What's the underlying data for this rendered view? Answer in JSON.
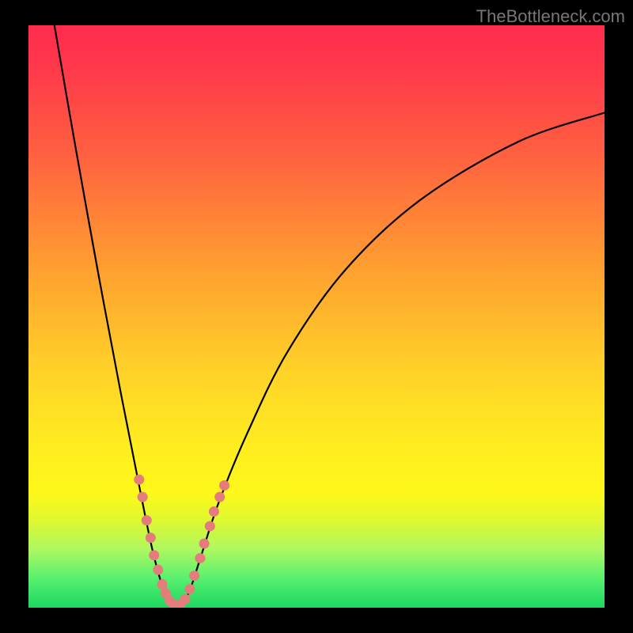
{
  "watermark": "TheBottleneck.com",
  "chart_data": {
    "type": "line",
    "title": "",
    "xlabel": "",
    "ylabel": "",
    "xlim": [
      0,
      100
    ],
    "ylim": [
      0,
      100
    ],
    "curve_points": [
      {
        "x": 4.5,
        "y": 100
      },
      {
        "x": 8,
        "y": 80
      },
      {
        "x": 12,
        "y": 58
      },
      {
        "x": 16,
        "y": 37
      },
      {
        "x": 19,
        "y": 22
      },
      {
        "x": 21.5,
        "y": 10
      },
      {
        "x": 23.5,
        "y": 3
      },
      {
        "x": 25,
        "y": 0.5
      },
      {
        "x": 26.5,
        "y": 0.5
      },
      {
        "x": 28,
        "y": 3
      },
      {
        "x": 30,
        "y": 9
      },
      {
        "x": 33,
        "y": 18
      },
      {
        "x": 38,
        "y": 30
      },
      {
        "x": 45,
        "y": 44
      },
      {
        "x": 55,
        "y": 58
      },
      {
        "x": 68,
        "y": 70
      },
      {
        "x": 85,
        "y": 80
      },
      {
        "x": 100,
        "y": 85
      }
    ],
    "series": [
      {
        "name": "data-points-left",
        "points": [
          {
            "x": 19.2,
            "y": 22
          },
          {
            "x": 19.8,
            "y": 19
          },
          {
            "x": 20.5,
            "y": 15
          },
          {
            "x": 21.2,
            "y": 12
          },
          {
            "x": 21.8,
            "y": 9
          },
          {
            "x": 22.5,
            "y": 6.5
          },
          {
            "x": 23.2,
            "y": 4
          },
          {
            "x": 23.8,
            "y": 2.5
          },
          {
            "x": 24.5,
            "y": 1.2
          },
          {
            "x": 25.3,
            "y": 0.5
          }
        ]
      },
      {
        "name": "data-points-right",
        "points": [
          {
            "x": 26.3,
            "y": 0.5
          },
          {
            "x": 27.2,
            "y": 1.5
          },
          {
            "x": 28,
            "y": 3.2
          },
          {
            "x": 28.8,
            "y": 5.5
          },
          {
            "x": 29.8,
            "y": 8.5
          },
          {
            "x": 30.5,
            "y": 11
          },
          {
            "x": 31.5,
            "y": 14
          },
          {
            "x": 32.2,
            "y": 16.5
          },
          {
            "x": 33.2,
            "y": 19
          },
          {
            "x": 34,
            "y": 21
          }
        ]
      }
    ]
  }
}
